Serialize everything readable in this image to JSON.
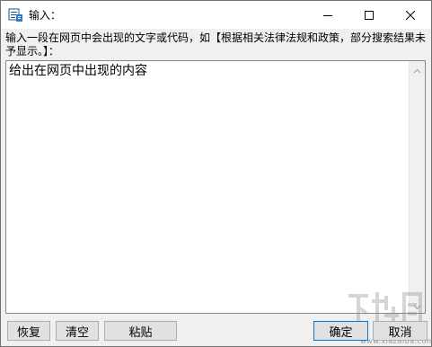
{
  "window": {
    "title": "输入："
  },
  "prompt": {
    "text": "输入一段在网页中会出现的文字或代码，如【根据相关法律法规和政策，部分搜索结果未予显示。】："
  },
  "textarea": {
    "value": "给出在网页中出现的内容"
  },
  "buttons": {
    "restore": "恢复",
    "clear": "清空",
    "paste": "粘贴",
    "ok": "确定",
    "cancel": "取消"
  },
  "watermark": {
    "url": "www.xiazaiba.com"
  },
  "icons": {
    "app": "app-icon",
    "minimize": "minimize-icon",
    "maximize": "maximize-icon",
    "close": "close-icon",
    "scroll_up": "chevron-up-icon",
    "scroll_down": "chevron-down-icon"
  },
  "colors": {
    "accent": "#0078d7",
    "window_bg": "#f0f0f0",
    "button_bg": "#e1e1e1"
  }
}
